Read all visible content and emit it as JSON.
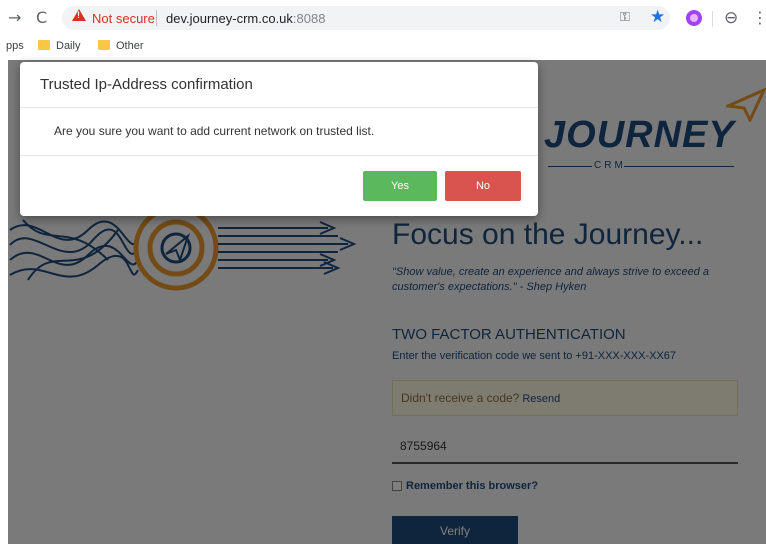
{
  "browser": {
    "security_label": "Not secure",
    "url_host": "dev.journey-crm.co.uk",
    "url_port": ":8088",
    "icons": [
      "forward-icon",
      "reload-icon",
      "warning-icon",
      "key-icon",
      "star-icon",
      "extension-icon",
      "profile-icon",
      "menu-icon"
    ]
  },
  "bookmarks": {
    "apps_label": "pps",
    "items": [
      {
        "label": "Daily"
      },
      {
        "label": "Other"
      }
    ]
  },
  "logo": {
    "name": "JOURNEY",
    "tagline": "CRM"
  },
  "hero": {
    "title": "Focus on the Journey...",
    "quote": "\"Show value, create an experience and always strive to exceed a customer's expectations.\" - Shep Hyken"
  },
  "tfa": {
    "heading": "TWO FACTOR AUTHENTICATION",
    "subheading": "Enter the verification code we sent to +91-XXX-XXX-XX67",
    "resend_prompt": "Didn't receive a code?",
    "resend_link": "Resend",
    "code_value": "8755964",
    "remember_label": "Remember this browser?",
    "remember_checked": false,
    "verify_label": "Verify"
  },
  "modal": {
    "title": "Trusted Ip-Address confirmation",
    "message": "Are you sure you want to add current network on trusted list.",
    "yes_label": "Yes",
    "no_label": "No"
  },
  "colors": {
    "brand": "#1e4a7a",
    "accent": "#e8962e",
    "yes": "#5cb85c",
    "no": "#d9534f"
  }
}
